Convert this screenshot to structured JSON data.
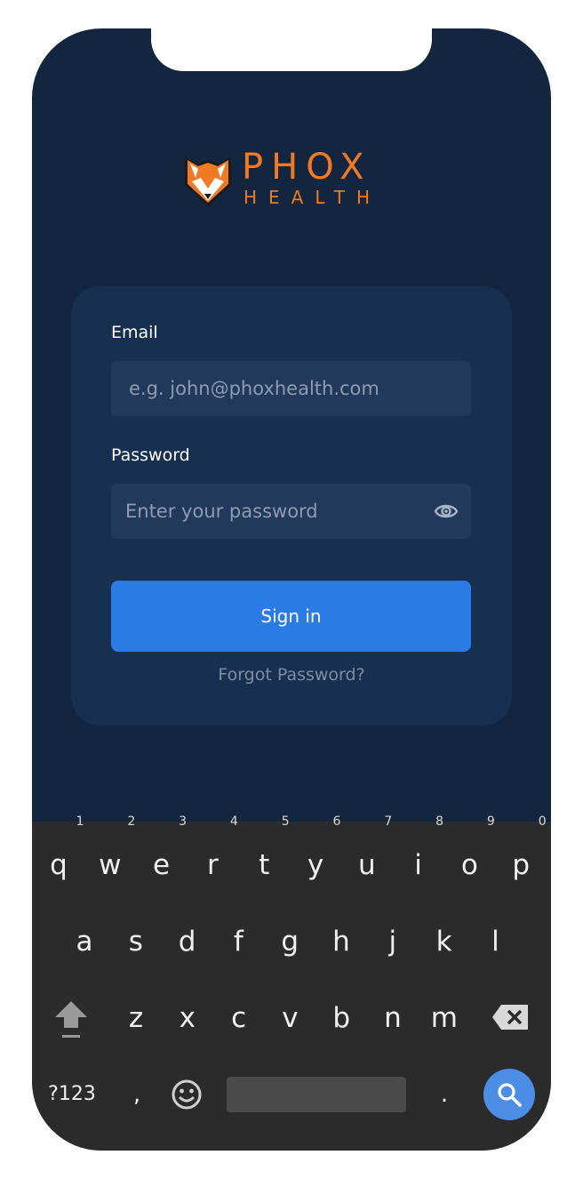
{
  "brand": {
    "name": "PHOX",
    "sub": "HEALTH",
    "color": "#ef7a23"
  },
  "form": {
    "email_label": "Email",
    "email_placeholder": "e.g. john@phoxhealth.com",
    "email_value": "",
    "password_label": "Password",
    "password_placeholder": "Enter your password",
    "password_value": "",
    "show_password_icon": "eye-icon",
    "signin_label": "Sign in",
    "forgot_label": "Forgot Password?"
  },
  "keyboard": {
    "row1": [
      {
        "key": "q",
        "hint": "1"
      },
      {
        "key": "w",
        "hint": "2"
      },
      {
        "key": "e",
        "hint": "3"
      },
      {
        "key": "r",
        "hint": "4"
      },
      {
        "key": "t",
        "hint": "5"
      },
      {
        "key": "y",
        "hint": "6"
      },
      {
        "key": "u",
        "hint": "7"
      },
      {
        "key": "i",
        "hint": "8"
      },
      {
        "key": "o",
        "hint": "9"
      },
      {
        "key": "p",
        "hint": "0"
      }
    ],
    "row2": [
      "a",
      "s",
      "d",
      "f",
      "g",
      "h",
      "j",
      "k",
      "l"
    ],
    "row3": [
      "z",
      "x",
      "c",
      "v",
      "b",
      "n",
      "m"
    ],
    "symbols_label": "?123",
    "comma_label": ",",
    "period_label": ".",
    "shift_icon": "shift-icon",
    "backspace_icon": "backspace-icon",
    "emoji_icon": "emoji-icon",
    "search_icon": "search-icon"
  },
  "colors": {
    "background": "#14253f",
    "card": "#17304f",
    "field": "#21395b",
    "button": "#2b7be4",
    "keyboard": "#2b2b2b"
  }
}
